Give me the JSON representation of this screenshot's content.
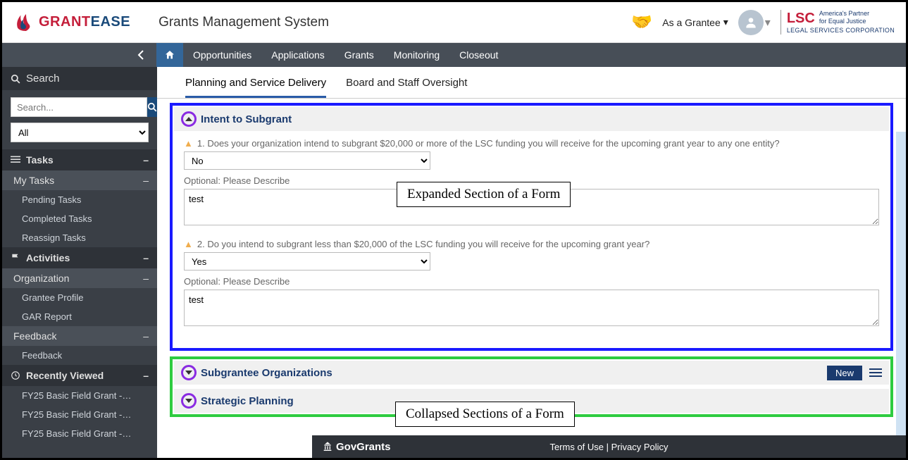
{
  "header": {
    "logo_grant": "GRANT",
    "logo_ease": "EASE",
    "system_title": "Grants Management System",
    "role_label": "As a Grantee",
    "lsc_top1": "America's Partner",
    "lsc_top2": "for Equal Justice",
    "lsc_main": "LSC",
    "lsc_sub": "LEGAL SERVICES CORPORATION"
  },
  "topnav": {
    "items": [
      "Opportunities",
      "Applications",
      "Grants",
      "Monitoring",
      "Closeout"
    ]
  },
  "sidebar": {
    "search_title": "Search",
    "search_placeholder": "Search...",
    "filter_value": "All",
    "tasks_title": "Tasks",
    "my_tasks": "My Tasks",
    "task_items": [
      "Pending Tasks",
      "Completed Tasks",
      "Reassign Tasks"
    ],
    "activities_title": "Activities",
    "organization": "Organization",
    "org_items": [
      "Grantee Profile",
      "GAR Report"
    ],
    "feedback_title": "Feedback",
    "feedback_items": [
      "Feedback"
    ],
    "recently_title": "Recently Viewed",
    "recent_items": [
      "FY25 Basic Field Grant -…",
      "FY25 Basic Field Grant -…",
      "FY25 Basic Field Grant -…"
    ]
  },
  "subtabs": {
    "tab1": "Planning and Service Delivery",
    "tab2": "Board and Staff Oversight"
  },
  "sections": {
    "intent_title": "Intent to Subgrant",
    "q1_text": "1. Does your organization intend to subgrant $20,000 or more of the LSC funding you will receive for the upcoming grant year to any one entity?",
    "q1_value": "No",
    "q1_desc_label": "Optional: Please Describe",
    "q1_desc_value": "test",
    "q2_text": "2. Do you intend to subgrant less than $20,000 of the LSC funding you will receive for the upcoming grant year?",
    "q2_value": "Yes",
    "q2_desc_label": "Optional: Please Describe",
    "q2_desc_value": "test",
    "sub_org_title": "Subgrantee Organizations",
    "new_btn": "New",
    "strategic_title": "Strategic Planning"
  },
  "callouts": {
    "expanded": "Expanded Section of a Form",
    "collapsed": "Collapsed Sections of a Form"
  },
  "footer": {
    "brand": "GovGrants",
    "links": "Terms of Use | Privacy Policy"
  }
}
